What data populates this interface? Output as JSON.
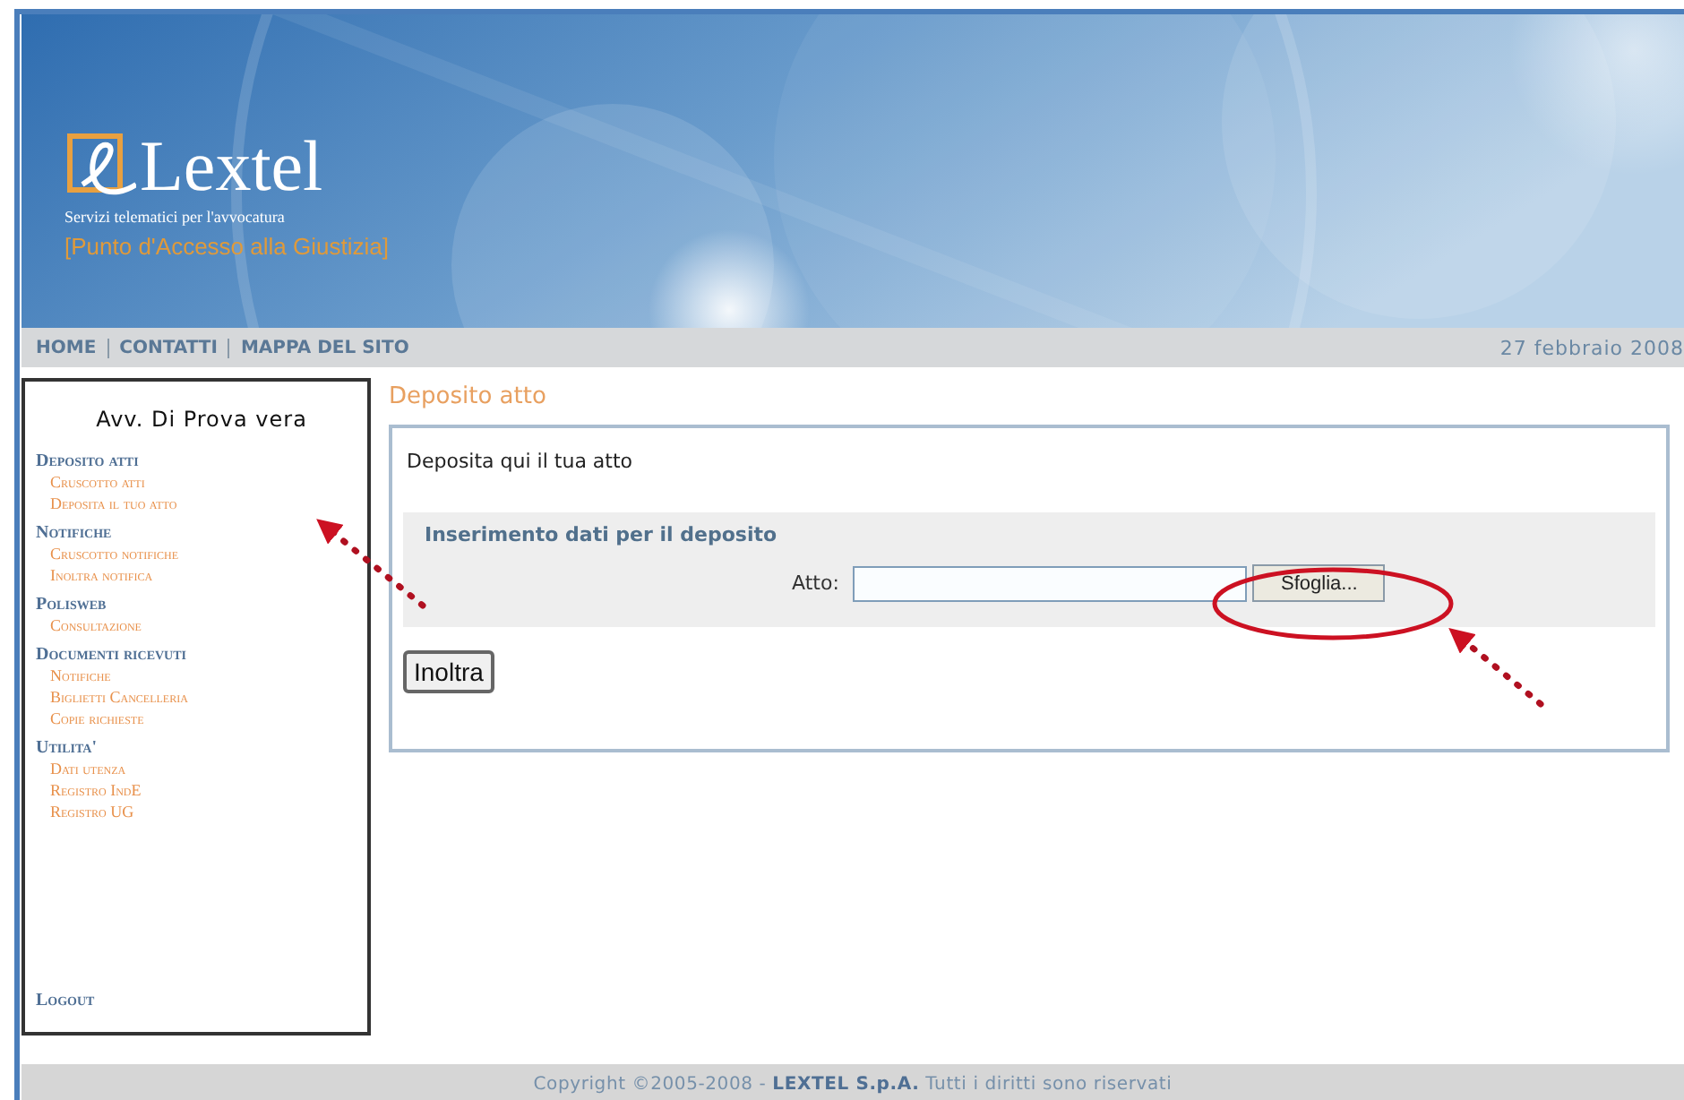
{
  "header": {
    "logo_text": "Lextel",
    "tagline": "Servizi telematici per l'avvocatura",
    "subtitle": "[Punto d'Accesso alla Giustizia]"
  },
  "nav": {
    "links": [
      "HOME",
      "CONTATTI",
      "MAPPA DEL SITO"
    ],
    "date": "27 febbraio 2008"
  },
  "sidebar": {
    "user": "Avv. Di Prova vera",
    "sections": [
      {
        "title": "Deposito atti",
        "items": [
          "Cruscotto atti",
          "Deposita il tuo atto"
        ]
      },
      {
        "title": "Notifiche",
        "items": [
          "Cruscotto notifiche",
          "Inoltra notifica"
        ]
      },
      {
        "title": "Polisweb",
        "items": [
          "Consultazione"
        ]
      },
      {
        "title": "Documenti ricevuti",
        "items": [
          "Notifiche",
          "Biglietti Cancelleria",
          "Copie richieste"
        ]
      },
      {
        "title": "Utilita'",
        "items": [
          "Dati utenza",
          "Registro IndE",
          "Registro UG"
        ]
      }
    ],
    "logout": "Logout"
  },
  "content": {
    "title": "Deposito atto",
    "intro": "Deposita qui il tua atto",
    "section_title": "Inserimento dati per il deposito",
    "field_label": "Atto:",
    "browse_button": "Sfoglia...",
    "submit_button": "Inoltra"
  },
  "footer": {
    "text": "Copyright ©2005-2008 - **LEXTEL S.p.A.** Tutti i diritti sono riservati"
  }
}
